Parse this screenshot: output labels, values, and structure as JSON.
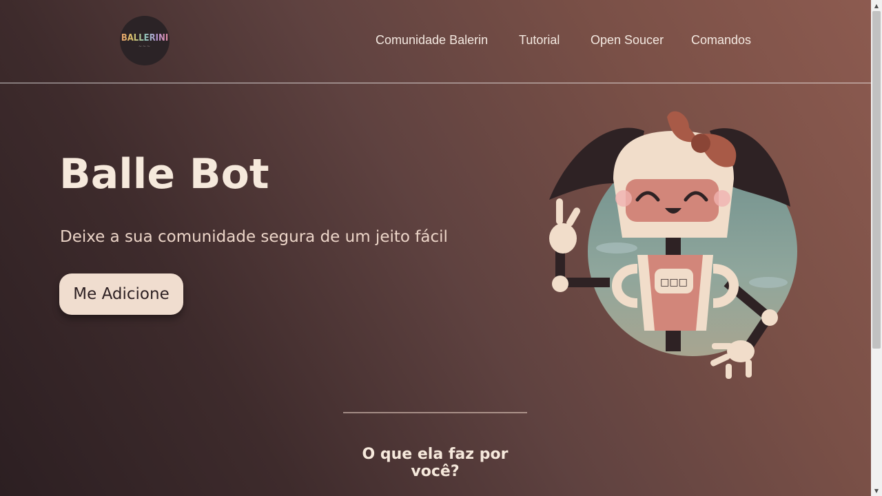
{
  "header": {
    "logo_text": "BALLERINI",
    "logo_sub": "~~~",
    "nav": [
      "Comunidade Balerin",
      "Tutorial",
      "Open Soucer",
      "Comandos"
    ]
  },
  "hero": {
    "title": "Balle Bot",
    "subtitle": "Deixe a sua comunidade segura de um jeito fácil",
    "cta_label": "Me Adicione"
  },
  "section": {
    "title": "O que ela faz por você?"
  },
  "robot": {
    "chest_display": "□□□"
  },
  "colors": {
    "text": "#f6e9dc",
    "button_bg": "#f0ddcf",
    "robot_pink": "#d2867a",
    "robot_cream": "#f1ddca",
    "hair": "#2e2224"
  },
  "icons": {
    "scroll_up": "▲",
    "scroll_down": "▼"
  }
}
